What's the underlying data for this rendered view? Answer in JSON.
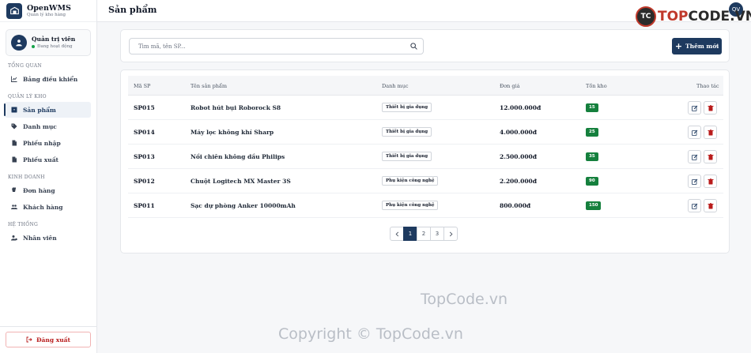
{
  "brand": {
    "name": "OpenWMS",
    "subtitle": "Quản lý kho hàng",
    "icon": "warehouse-icon"
  },
  "user": {
    "name": "Quản trị viên",
    "status": "Đang hoạt động",
    "status_color": "#16a34a",
    "icon": "user-icon"
  },
  "sidebar": {
    "sections": [
      {
        "label": "TỔNG QUAN",
        "items": [
          {
            "label": "Bảng điều khiển",
            "icon": "chart-line-icon",
            "active": false
          }
        ]
      },
      {
        "label": "QUẢN LÝ KHO",
        "items": [
          {
            "label": "Sản phẩm",
            "icon": "box-icon",
            "active": true
          },
          {
            "label": "Danh mục",
            "icon": "tags-icon",
            "active": false
          },
          {
            "label": "Phiếu nhập",
            "icon": "file-import-icon",
            "active": false
          },
          {
            "label": "Phiếu xuất",
            "icon": "file-export-icon",
            "active": false
          }
        ]
      },
      {
        "label": "KINH DOANH",
        "items": [
          {
            "label": "Đơn hàng",
            "icon": "cart-icon",
            "active": false
          },
          {
            "label": "Khách hàng",
            "icon": "users-icon",
            "active": false
          }
        ]
      },
      {
        "label": "HỆ THỐNG",
        "items": [
          {
            "label": "Nhân viên",
            "icon": "user-gear-icon",
            "active": false
          }
        ]
      }
    ],
    "logout_label": "Đăng xuất"
  },
  "header": {
    "title": "Sản phẩm",
    "avatar_initials": "QV"
  },
  "watermark": {
    "logo_prefix": "TOP",
    "logo_suffix": "CODE.VN",
    "logo_mark": "TC",
    "text1": "TopCode.vn",
    "text2": "Copyright © TopCode.vn"
  },
  "search": {
    "placeholder": "Tìm mã, tên SP...",
    "value": ""
  },
  "add_button": {
    "label": "Thêm mới"
  },
  "table": {
    "columns": [
      "Mã SP",
      "Tên sản phẩm",
      "Danh mục",
      "Đơn giá",
      "Tồn kho",
      "Thao tác"
    ],
    "rows": [
      {
        "code": "SP015",
        "name": "Robot hút bụi Roborock S8",
        "category": "Thiết bị gia dụng",
        "price": "12.000.000đ",
        "stock": "15"
      },
      {
        "code": "SP014",
        "name": "Máy lọc không khí Sharp",
        "category": "Thiết bị gia dụng",
        "price": "4.000.000đ",
        "stock": "25"
      },
      {
        "code": "SP013",
        "name": "Nồi chiên không dầu Philips",
        "category": "Thiết bị gia dụng",
        "price": "2.500.000đ",
        "stock": "35"
      },
      {
        "code": "SP012",
        "name": "Chuột Logitech MX Master 3S",
        "category": "Phụ kiện công nghệ",
        "price": "2.200.000đ",
        "stock": "90"
      },
      {
        "code": "SP011",
        "name": "Sạc dự phòng Anker 10000mAh",
        "category": "Phụ kiện công nghệ",
        "price": "800.000đ",
        "stock": "150"
      }
    ]
  },
  "pagination": {
    "pages": [
      "1",
      "2",
      "3"
    ],
    "current": "1"
  },
  "colors": {
    "primary": "#1e3a5f",
    "danger": "#b91c1c",
    "stock_badge": "#15803d"
  }
}
